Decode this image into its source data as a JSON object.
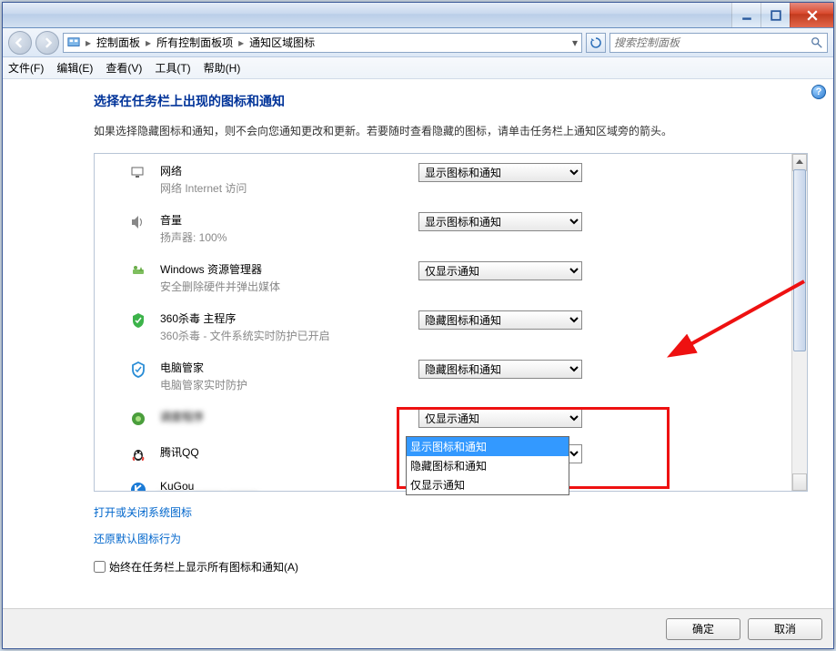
{
  "window": {
    "min_tooltip": "最小化",
    "max_tooltip": "最大化",
    "close_tooltip": "关闭"
  },
  "breadcrumb": {
    "items": [
      "控制面板",
      "所有控制面板项",
      "通知区域图标"
    ]
  },
  "search": {
    "placeholder": "搜索控制面板"
  },
  "menu": {
    "file": "文件(F)",
    "edit": "编辑(E)",
    "view": "查看(V)",
    "tools": "工具(T)",
    "help": "帮助(H)"
  },
  "page": {
    "title": "选择在任务栏上出现的图标和通知",
    "desc": "如果选择隐藏图标和通知，则不会向您通知更改和更新。若要随时查看隐藏的图标，请单击任务栏上通知区域旁的箭头。"
  },
  "options": {
    "show_icon_notify": "显示图标和通知",
    "hide_icon_notify": "隐藏图标和通知",
    "only_notify": "仅显示通知"
  },
  "items": [
    {
      "name": "网络",
      "sub": "网络 Internet 访问",
      "value": "显示图标和通知",
      "icon": "network"
    },
    {
      "name": "音量",
      "sub": "扬声器: 100%",
      "value": "显示图标和通知",
      "icon": "volume"
    },
    {
      "name": "Windows 资源管理器",
      "sub": "安全删除硬件并弹出媒体",
      "value": "仅显示通知",
      "icon": "explorer"
    },
    {
      "name": "360杀毒 主程序",
      "sub": "360杀毒 - 文件系统实时防护已开启",
      "value": "隐藏图标和通知",
      "icon": "shield-green"
    },
    {
      "name": "电脑管家",
      "sub": "电脑管家实时防护",
      "value": "隐藏图标和通知",
      "icon": "shield-blue"
    },
    {
      "name": "调度程序",
      "sub": "",
      "value": "仅显示通知",
      "icon": "scheduler",
      "blur_name": true
    },
    {
      "name": "腾讯QQ",
      "sub": "",
      "value": "显示图标和通知",
      "icon": "qq",
      "open": true
    },
    {
      "name": "KuGou",
      "sub": "",
      "value": "",
      "icon": "kugou",
      "blur_sub": true
    }
  ],
  "links": {
    "toggle_system": "打开或关闭系统图标",
    "restore_default": "还原默认图标行为"
  },
  "checkbox": {
    "label": "始终在任务栏上显示所有图标和通知(A)"
  },
  "buttons": {
    "ok": "确定",
    "cancel": "取消"
  }
}
